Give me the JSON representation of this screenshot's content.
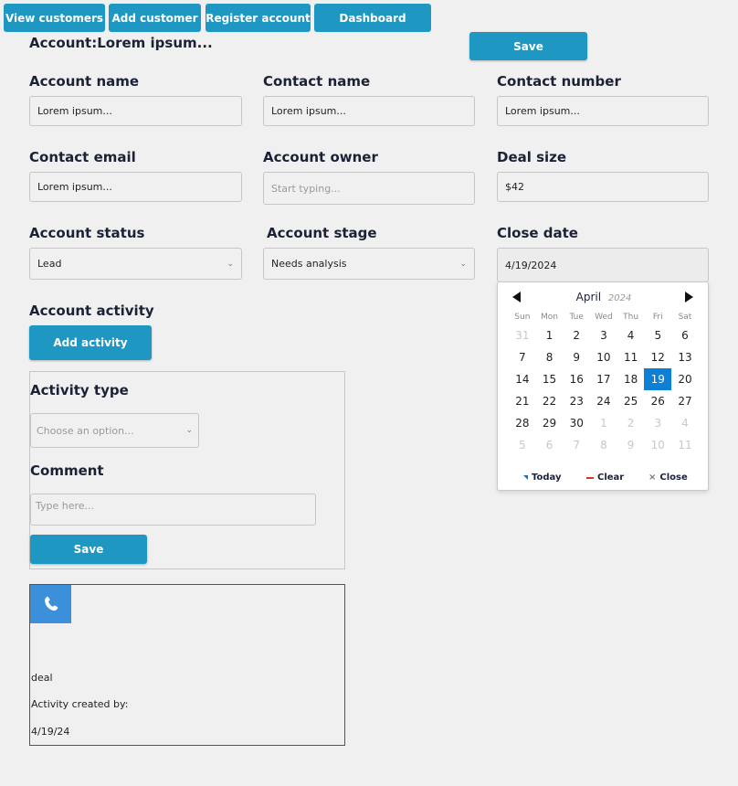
{
  "nav": {
    "view_customers": "View customers",
    "add_customer": "Add customer",
    "register_account": "Register account",
    "dashboard": "Dashboard"
  },
  "account": {
    "title": "Account:Lorem ipsum...",
    "save_label": "Save"
  },
  "fields": {
    "account_name": {
      "label": "Account name",
      "value": "Lorem ipsum..."
    },
    "contact_name": {
      "label": "Contact name",
      "value": "Lorem ipsum..."
    },
    "contact_number": {
      "label": "Contact number",
      "value": "Lorem ipsum..."
    },
    "contact_email": {
      "label": "Contact email",
      "value": "Lorem ipsum..."
    },
    "account_owner": {
      "label": "Account owner",
      "placeholder": "Start typing..."
    },
    "deal_size": {
      "label": "Deal size",
      "value": "$42"
    },
    "account_status": {
      "label": "Account status",
      "value": "Lead"
    },
    "account_stage": {
      "label": "Account stage",
      "value": "Needs analysis"
    },
    "close_date": {
      "label": "Close date",
      "value": "4/19/2024"
    }
  },
  "calendar": {
    "month": "April",
    "year": "2024",
    "weekdays": [
      "Sun",
      "Mon",
      "Tue",
      "Wed",
      "Thu",
      "Fri",
      "Sat"
    ],
    "weeks": [
      [
        "31",
        "1",
        "2",
        "3",
        "4",
        "5",
        "6"
      ],
      [
        "7",
        "8",
        "9",
        "10",
        "11",
        "12",
        "13"
      ],
      [
        "14",
        "15",
        "16",
        "17",
        "18",
        "19",
        "20"
      ],
      [
        "21",
        "22",
        "23",
        "24",
        "25",
        "26",
        "27"
      ],
      [
        "28",
        "29",
        "30",
        "1",
        "2",
        "3",
        "4"
      ],
      [
        "5",
        "6",
        "7",
        "8",
        "9",
        "10",
        "11"
      ]
    ],
    "selected_day": "19",
    "today_label": "Today",
    "clear_label": "Clear",
    "close_label": "Close",
    "accent": "#0d7fd6"
  },
  "activity": {
    "section_label": "Account activity",
    "add_button": "Add activity",
    "type_label": "Activity type",
    "type_placeholder": "Choose an option...",
    "comment_label": "Comment",
    "comment_placeholder": "Type here...",
    "save_label": "Save"
  },
  "activity_card": {
    "icon": "phone-icon",
    "type": "deal",
    "created_by": "Activity created by:",
    "date": "4/19/24"
  },
  "colors": {
    "primary": "#1e97c2",
    "icon_bg": "#3c8fdb",
    "text": "#1b2236"
  }
}
